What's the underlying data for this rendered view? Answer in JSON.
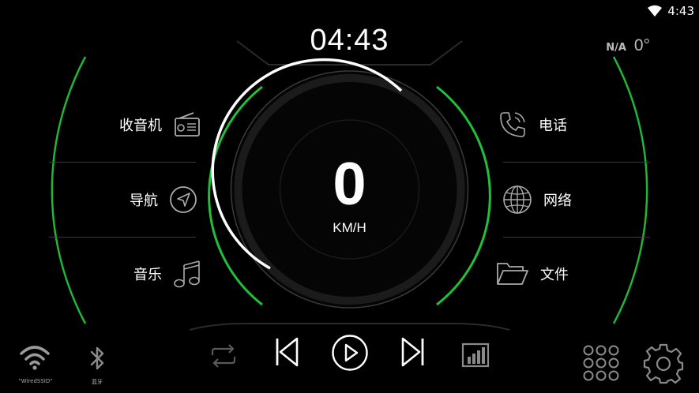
{
  "status_bar": {
    "time": "4:43"
  },
  "clock": {
    "time": "04:43"
  },
  "weather": {
    "condition": "N/A",
    "temperature": "0°"
  },
  "left_menu": [
    {
      "label": "收音机",
      "icon": "radio-icon"
    },
    {
      "label": "导航",
      "icon": "navigation-icon"
    },
    {
      "label": "音乐",
      "icon": "music-icon"
    }
  ],
  "right_menu": [
    {
      "label": "电话",
      "icon": "phone-icon"
    },
    {
      "label": "网络",
      "icon": "globe-icon"
    },
    {
      "label": "文件",
      "icon": "folder-icon"
    }
  ],
  "speedometer": {
    "speed": "0",
    "unit": "KM/H"
  },
  "bottom_bar": {
    "wifi_label": "\"WiredSSID\"",
    "bluetooth_label": "蓝牙"
  },
  "colors": {
    "accent": "#22c03a",
    "background": "#000000",
    "muted_icon": "#8a8a8a"
  }
}
